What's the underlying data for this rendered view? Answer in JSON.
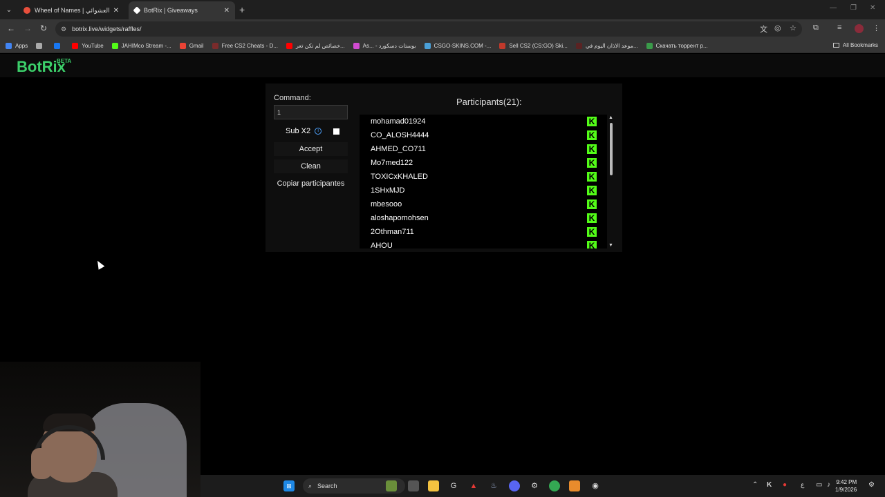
{
  "browser": {
    "tabs": [
      {
        "title": "Wheel of Names | اسم العشوائي",
        "active": false,
        "color": "#e84f3c"
      },
      {
        "title": "BotRix | Giveaways",
        "active": true,
        "color": "#ffffff"
      }
    ],
    "url": "botrix.live/widgets/raffles/",
    "bookmarks": [
      {
        "label": "Apps",
        "icon": "apps-grid-icon",
        "color": "#4285f4"
      },
      {
        "label": "",
        "icon": "grid-icon",
        "color": "#aaaaaa"
      },
      {
        "label": "",
        "icon": "facebook-icon",
        "color": "#1877f2"
      },
      {
        "label": "YouTube",
        "icon": "youtube-icon",
        "color": "#ff0000"
      },
      {
        "label": "JAHIMco Stream -...",
        "icon": "kick-icon",
        "color": "#53fc18"
      },
      {
        "label": "Gmail",
        "icon": "gmail-icon",
        "color": "#ea4335"
      },
      {
        "label": "Free CS2 Cheats - D...",
        "icon": "cheat-icon",
        "color": "#7a2b2b"
      },
      {
        "label": "خصائص لم تكن تعر...",
        "icon": "youtube-icon",
        "color": "#ff0000"
      },
      {
        "label": "As... - بوستات دسكورد",
        "icon": "gem-icon",
        "color": "#d14bd1"
      },
      {
        "label": "CSGO-SKINS.COM -...",
        "icon": "csgo-icon",
        "color": "#4aa0d8"
      },
      {
        "label": "Sell CS2 (CS:GO) Ski...",
        "icon": "skins-icon",
        "color": "#c0392b"
      },
      {
        "label": "موعد الاذان اليوم في...",
        "icon": "mosque-icon",
        "color": "#5a2323"
      },
      {
        "label": "Скачать торрент р...",
        "icon": "torrent-icon",
        "color": "#3a9b4a"
      }
    ],
    "all_bookmarks": "All Bookmarks"
  },
  "app": {
    "logo": "BotRix",
    "beta": "BETA"
  },
  "raffle": {
    "command_label": "Command:",
    "command_value": "1",
    "sub_label": "Sub X2",
    "sub_checked": false,
    "accept_label": "Accept",
    "clean_label": "Clean",
    "copy_label": "Copiar participantes",
    "participants_title": "Participants(21):",
    "participants": [
      "mohamad01924",
      "CO_ALOSH4444",
      "AHMED_CO711",
      "Mo7med122",
      "TOXICxKHALED",
      "1SHxMJD",
      "mbesooo",
      "aloshapomohsen",
      "2Othman711",
      "AHOU"
    ]
  },
  "taskbar": {
    "search_label": "Search",
    "time": "9:42 PM",
    "date": "1/9/2026",
    "lang": "ع"
  }
}
